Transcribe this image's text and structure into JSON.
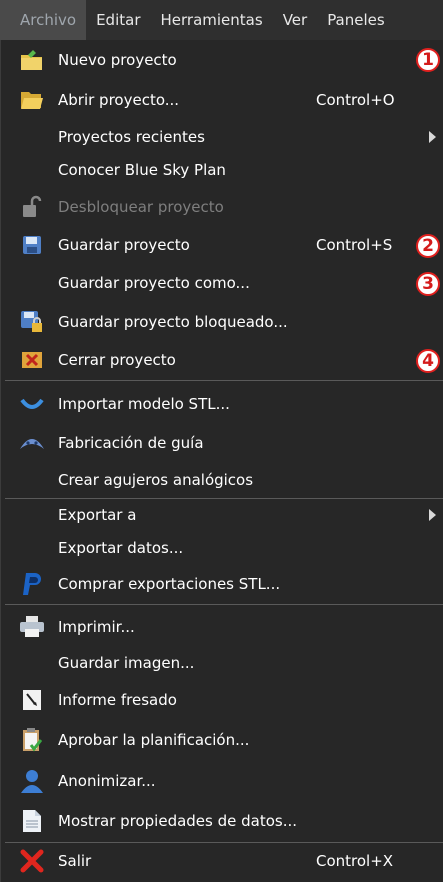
{
  "menubar": {
    "items": [
      "Archivo",
      "Editar",
      "Herramientas",
      "Ver",
      "Paneles"
    ]
  },
  "menu": {
    "items": [
      {
        "label": "Nuevo proyecto",
        "icon": "new-project-folder-icon"
      },
      {
        "label": "Abrir proyecto...",
        "shortcut": "Control+O",
        "icon": "open-folder-icon"
      },
      {
        "label": "Proyectos recientes",
        "submenu": true
      },
      {
        "label": "Conocer Blue Sky Plan"
      },
      {
        "label": "Desbloquear proyecto",
        "disabled": true,
        "icon": "unlock-padlock-icon"
      },
      {
        "label": "Guardar proyecto",
        "shortcut": "Control+S",
        "icon": "floppy-disk-icon"
      },
      {
        "label": "Guardar proyecto como..."
      },
      {
        "label": "Guardar proyecto bloqueado...",
        "icon": "floppy-lock-icon"
      },
      {
        "label": "Cerrar proyecto",
        "icon": "close-project-icon"
      },
      {
        "label": "Importar modelo STL...",
        "icon": "dental-arch-icon"
      },
      {
        "label": "Fabricación de guía",
        "icon": "surgical-guide-icon"
      },
      {
        "label": "Crear agujeros analógicos"
      },
      {
        "label": "Exportar a",
        "submenu": true
      },
      {
        "label": "Exportar datos..."
      },
      {
        "label": "Comprar exportaciones STL...",
        "icon": "paypal-icon"
      },
      {
        "label": "Imprimir...",
        "icon": "printer-icon"
      },
      {
        "label": "Guardar imagen..."
      },
      {
        "label": "Informe fresado",
        "icon": "milling-report-icon"
      },
      {
        "label": "Aprobar la planificación...",
        "icon": "clipboard-check-icon"
      },
      {
        "label": "Anonimizar...",
        "icon": "user-silhouette-icon"
      },
      {
        "label": "Mostrar propiedades de datos...",
        "icon": "document-icon"
      },
      {
        "label": "Salir",
        "shortcut": "Control+X",
        "icon": "red-x-icon"
      }
    ]
  },
  "badges": [
    "1",
    "2",
    "3",
    "4"
  ],
  "colors": {
    "menu_bg": "#272727",
    "badge_border": "#e0201e",
    "disabled_text": "#7e7e7e"
  }
}
